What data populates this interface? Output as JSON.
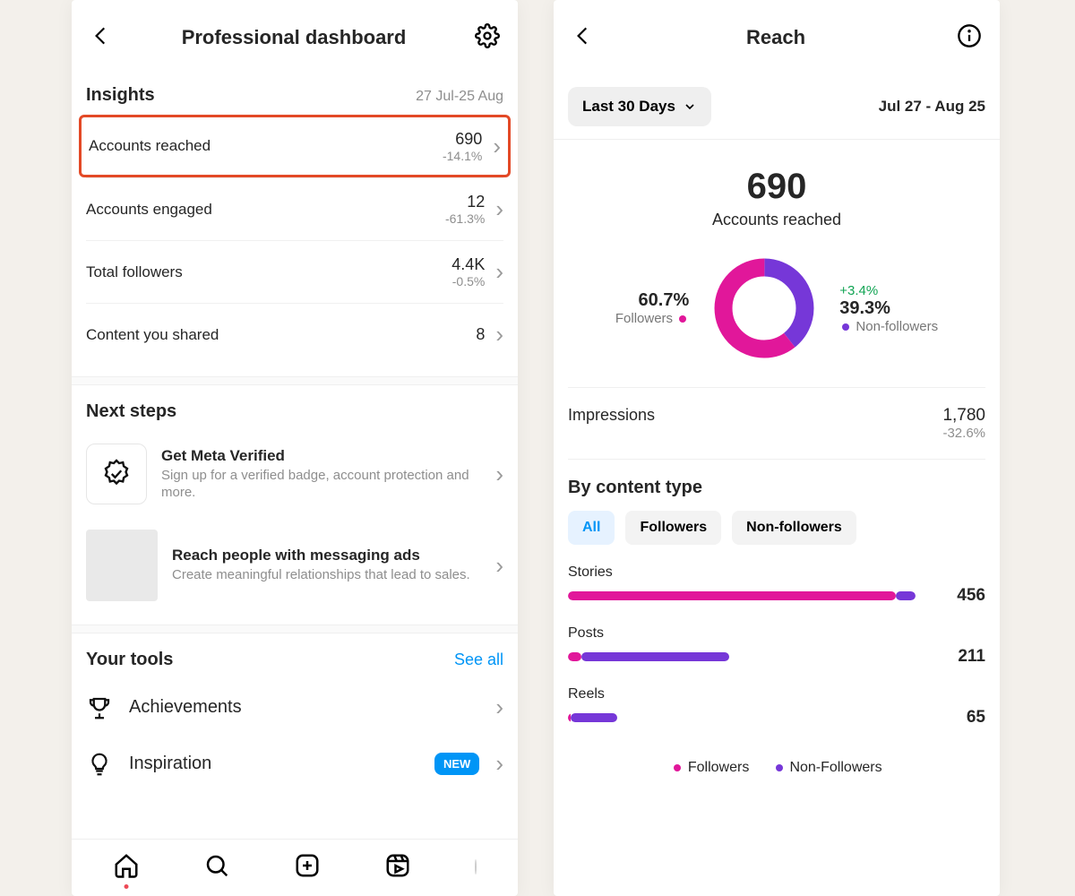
{
  "left": {
    "header_title": "Professional dashboard",
    "insights": {
      "title": "Insights",
      "period": "27 Jul-25 Aug",
      "rows": [
        {
          "label": "Accounts reached",
          "value": "690",
          "delta": "-14.1%"
        },
        {
          "label": "Accounts engaged",
          "value": "12",
          "delta": "-61.3%"
        },
        {
          "label": "Total followers",
          "value": "4.4K",
          "delta": "-0.5%"
        },
        {
          "label": "Content you shared",
          "value": "8",
          "delta": ""
        }
      ]
    },
    "next_steps": {
      "title": "Next steps",
      "cards": [
        {
          "title": "Get Meta Verified",
          "sub": "Sign up for a verified badge, account protection and more."
        },
        {
          "title": "Reach people with messaging ads",
          "sub": "Create meaningful relationships that lead to sales."
        }
      ]
    },
    "tools": {
      "title": "Your tools",
      "see_all": "See all",
      "rows": [
        {
          "label": "Achievements",
          "badge": ""
        },
        {
          "label": "Inspiration",
          "badge": "NEW"
        }
      ]
    }
  },
  "right": {
    "header_title": "Reach",
    "filter": {
      "label": "Last 30 Days",
      "range": "Jul 27 - Aug 25"
    },
    "hero": {
      "value": "690",
      "label": "Accounts reached"
    },
    "donut": {
      "followers": {
        "pct": "60.7%",
        "label": "Followers"
      },
      "nonfollowers": {
        "pct": "39.3%",
        "label": "Non-followers",
        "delta": "+3.4%"
      }
    },
    "impressions": {
      "label": "Impressions",
      "value": "1,780",
      "delta": "-32.6%"
    },
    "by_content": {
      "title": "By content type",
      "tabs": [
        "All",
        "Followers",
        "Non-followers"
      ],
      "legend": {
        "followers": "Followers",
        "nonfollowers": "Non-Followers"
      }
    }
  },
  "chart_data": {
    "donut": {
      "type": "pie",
      "title": "Accounts reached split",
      "series": [
        {
          "name": "Followers",
          "value": 60.7,
          "color": "#e1179a"
        },
        {
          "name": "Non-followers",
          "value": 39.3,
          "color": "#7637d8"
        }
      ]
    },
    "by_content_type": {
      "type": "bar",
      "title": "Reach by content type",
      "xlabel": "",
      "ylabel": "Accounts reached",
      "categories": [
        "Stories",
        "Posts",
        "Reels"
      ],
      "totals": [
        456,
        211,
        65
      ],
      "series": [
        {
          "name": "Followers",
          "color": "#e1179a",
          "values": [
            430,
            18,
            4
          ]
        },
        {
          "name": "Non-followers",
          "color": "#7637d8",
          "values": [
            26,
            193,
            61
          ]
        }
      ],
      "ylim": [
        0,
        456
      ]
    }
  }
}
